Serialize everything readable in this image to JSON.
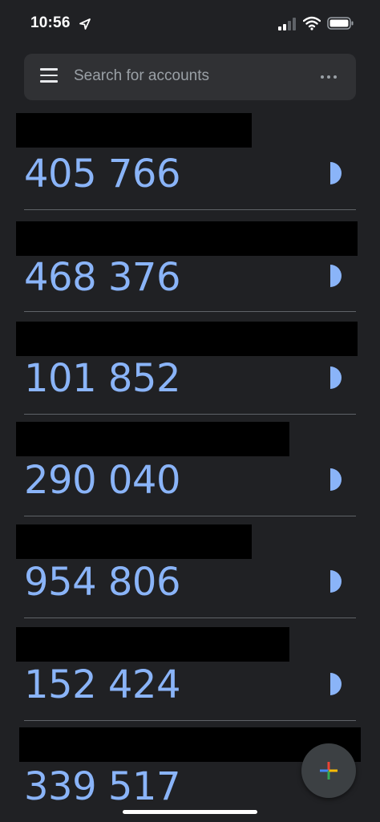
{
  "status_bar": {
    "time": "10:56",
    "icons": [
      "location-arrow-icon",
      "cellular-signal-icon",
      "wifi-icon",
      "battery-icon"
    ]
  },
  "search": {
    "placeholder": "Search for accounts",
    "menu_icon": "hamburger-menu-icon",
    "more_icon": "more-horizontal-icon"
  },
  "accounts": [
    {
      "code": "405 766"
    },
    {
      "code": "468 376"
    },
    {
      "code": "101 852"
    },
    {
      "code": "290 040"
    },
    {
      "code": "954 806"
    },
    {
      "code": "152 424"
    },
    {
      "code": "339 517"
    }
  ],
  "fab": {
    "icon": "add-plus-icon"
  },
  "colors": {
    "background": "#202124",
    "search_bar": "#303134",
    "code_text": "#8ab4f8",
    "timer": "#8ab4f8",
    "divider": "#5f6368",
    "fab": "#3c4043",
    "redaction": "#000000"
  }
}
